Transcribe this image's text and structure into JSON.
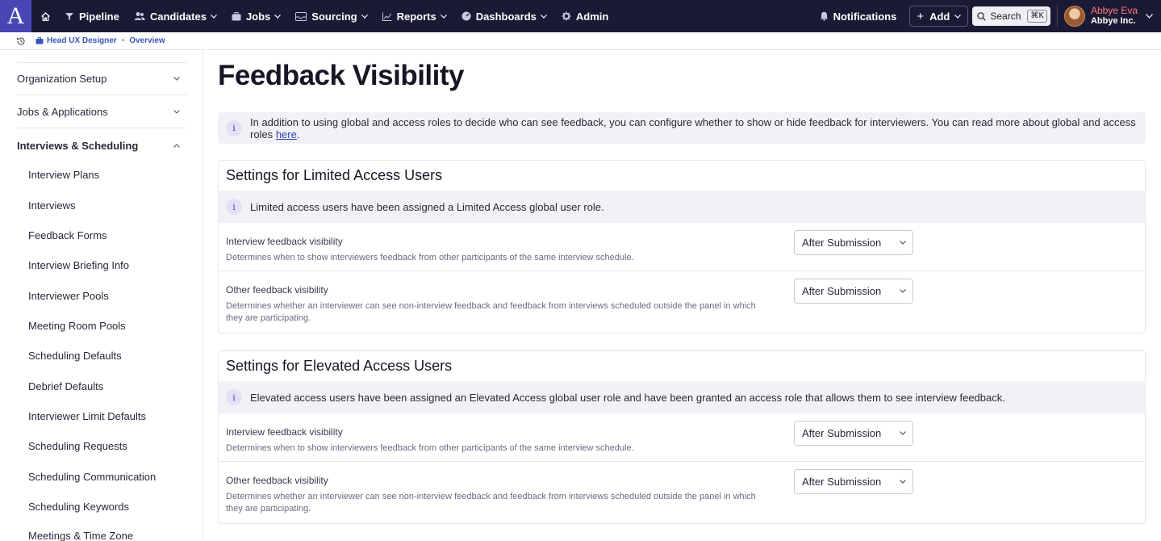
{
  "nav": {
    "logo": "A",
    "items": [
      {
        "label": "Pipeline",
        "has_menu": false
      },
      {
        "label": "Candidates",
        "has_menu": true
      },
      {
        "label": "Jobs",
        "has_menu": true
      },
      {
        "label": "Sourcing",
        "has_menu": true
      },
      {
        "label": "Reports",
        "has_menu": true
      },
      {
        "label": "Dashboards",
        "has_menu": true
      },
      {
        "label": "Admin",
        "has_menu": false
      }
    ],
    "notifications": "Notifications",
    "add": "Add",
    "search": "Search",
    "search_shortcut": "⌘K",
    "user_name": "Abbye Eva",
    "user_org": "Abbye Inc."
  },
  "breadcrumb": {
    "job": "Head UX Designer",
    "page": "Overview"
  },
  "sidebar": {
    "groups": [
      {
        "label": "Organization Setup",
        "expanded": false
      },
      {
        "label": "Jobs & Applications",
        "expanded": false
      },
      {
        "label": "Interviews & Scheduling",
        "expanded": true
      }
    ],
    "sub_items": [
      "Interview Plans",
      "Interviews",
      "Feedback Forms",
      "Interview Briefing Info",
      "Interviewer Pools",
      "Meeting Room Pools",
      "Scheduling Defaults",
      "Debrief Defaults",
      "Interviewer Limit Defaults",
      "Scheduling Requests",
      "Scheduling Communication",
      "Scheduling Keywords",
      "Meetings & Time Zone"
    ]
  },
  "main": {
    "title": "Feedback Visibility",
    "info": "In addition to using global and access roles to decide who can see feedback, you can configure whether to show or hide feedback for interviewers. You can read more about global and access roles",
    "info_link": "here",
    "info_end": ".",
    "limited": {
      "title": "Settings for Limited Access Users",
      "note": "Limited access users have been assigned a Limited Access global user role.",
      "interview_title": "Interview feedback visibility",
      "interview_desc": "Determines when to show interviewers feedback from other participants of the same interview schedule.",
      "interview_value": "After Submission",
      "other_title": "Other feedback visibility",
      "other_desc": "Determines whether an interviewer can see non-interview feedback and feedback from interviews scheduled outside the panel in which they are participating.",
      "other_value": "After Submission"
    },
    "elevated": {
      "title": "Settings for Elevated Access Users",
      "note": "Elevated access users have been assigned an Elevated Access global user role and have been granted an access role that allows them to see interview feedback.",
      "interview_title": "Interview feedback visibility",
      "interview_desc": "Determines when to show interviewers feedback from other participants of the same interview schedule.",
      "interview_value": "After Submission",
      "other_title": "Other feedback visibility",
      "other_desc": "Determines whether an interviewer can see non-interview feedback and feedback from interviews scheduled outside the panel in which they are participating.",
      "other_value": "After Submission"
    }
  },
  "colors": {
    "topbar": "#1b1a35",
    "brand": "#4a45b4",
    "link": "#2b3fb8",
    "user_name": "#ff7b7b"
  }
}
